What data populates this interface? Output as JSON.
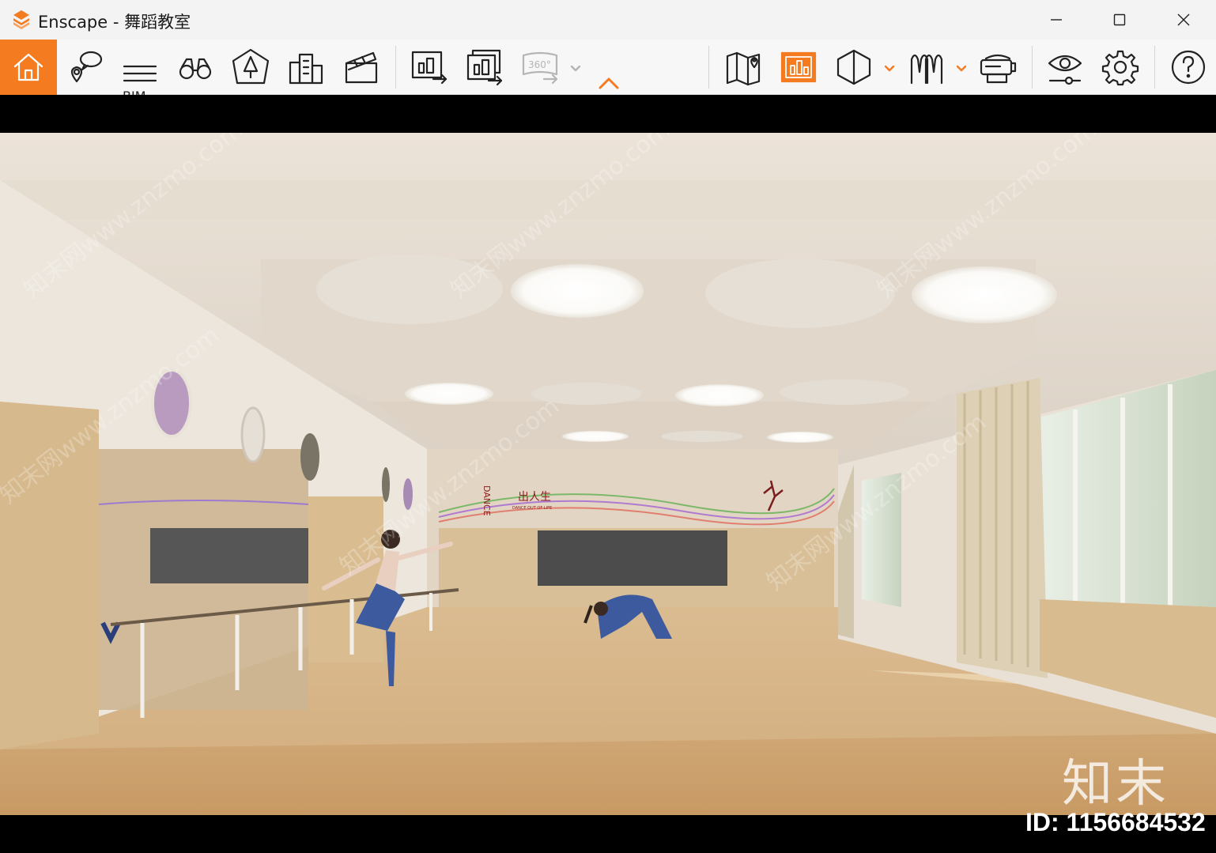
{
  "window": {
    "title": "Enscape - 舞蹈教室",
    "minimize_icon": "minimize-icon",
    "maximize_icon": "maximize-icon",
    "close_icon": "close-icon"
  },
  "toolbar": {
    "accent_color": "#f47b20",
    "bim_label": "BIM",
    "pano_label": "360°",
    "tools": [
      {
        "name": "home",
        "icon": "home-icon",
        "active": true
      },
      {
        "name": "views",
        "icon": "location-chat-icon"
      },
      {
        "name": "bim",
        "icon": "bim-icon"
      },
      {
        "name": "binoculars",
        "icon": "binoculars-icon"
      },
      {
        "name": "asset-library",
        "icon": "asset-library-icon"
      },
      {
        "name": "buildings",
        "icon": "buildings-icon"
      },
      {
        "name": "video-editor",
        "icon": "clapperboard-icon"
      },
      {
        "name": "screenshot",
        "icon": "render-export-icon"
      },
      {
        "name": "batch-render",
        "icon": "batch-render-icon"
      },
      {
        "name": "panorama",
        "icon": "panorama-360-icon",
        "disabled": true
      },
      {
        "name": "map",
        "icon": "map-icon"
      },
      {
        "name": "capture-view",
        "icon": "capture-view-icon",
        "highlighted": true
      },
      {
        "name": "section",
        "icon": "section-cube-icon"
      },
      {
        "name": "people",
        "icon": "people-icon"
      },
      {
        "name": "vr",
        "icon": "vr-headset-icon"
      },
      {
        "name": "visual-settings",
        "icon": "eye-slider-icon"
      },
      {
        "name": "settings",
        "icon": "gear-icon"
      },
      {
        "name": "help",
        "icon": "help-icon"
      }
    ]
  },
  "scene": {
    "sign_text": "出人生",
    "sign_vertical": "DANCE",
    "sign_sub": "DANCE OUT OF LIFE"
  },
  "watermarks": {
    "brand": "知末",
    "id": "ID: 1156684532",
    "diag": "知末网www.znzmo.com"
  }
}
